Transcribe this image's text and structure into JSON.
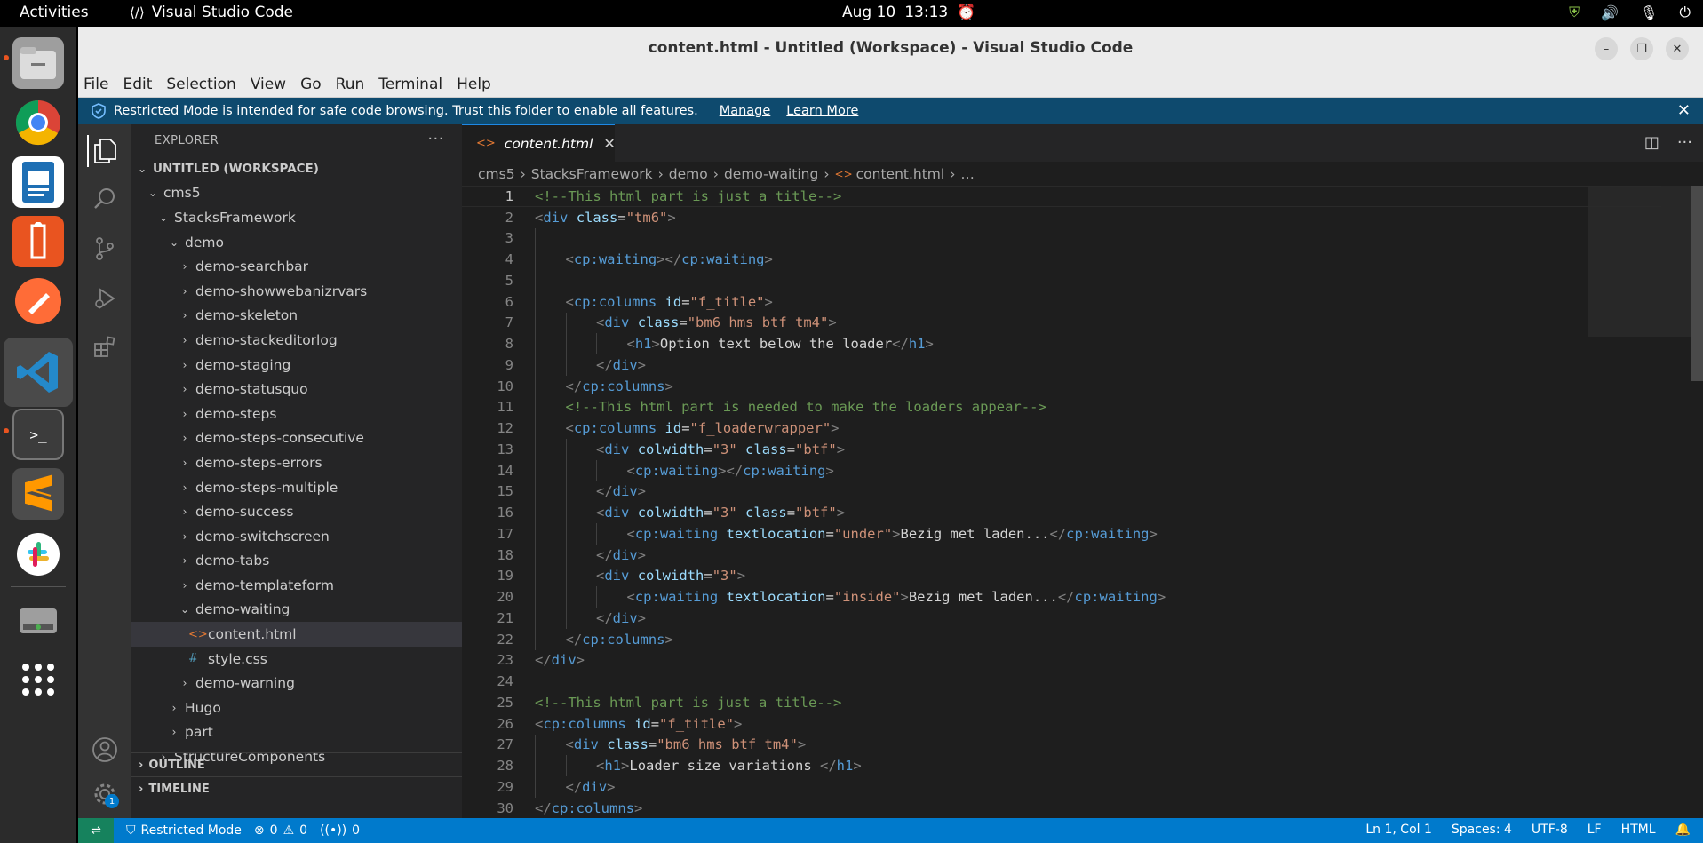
{
  "topbar": {
    "activities": "Activities",
    "app_name": "Visual Studio Code",
    "date": "Aug 10",
    "time": "13:13"
  },
  "window": {
    "title": "content.html - Untitled (Workspace) - Visual Studio Code"
  },
  "menu": [
    "File",
    "Edit",
    "Selection",
    "View",
    "Go",
    "Run",
    "Terminal",
    "Help"
  ],
  "banner": {
    "text": "Restricted Mode is intended for safe code browsing. Trust this folder to enable all features.",
    "manage": "Manage",
    "learn_more": "Learn More"
  },
  "explorer": {
    "header": "EXPLORER",
    "workspace": "UNTITLED (WORKSPACE)",
    "tree": [
      {
        "label": "cms5",
        "depth": 1,
        "chev": "⌄"
      },
      {
        "label": "StacksFramework",
        "depth": 2,
        "chev": "⌄"
      },
      {
        "label": "demo",
        "depth": 3,
        "chev": "⌄"
      },
      {
        "label": "demo-searchbar",
        "depth": 4,
        "chev": "›"
      },
      {
        "label": "demo-showwebanizrvars",
        "depth": 4,
        "chev": "›"
      },
      {
        "label": "demo-skeleton",
        "depth": 4,
        "chev": "›"
      },
      {
        "label": "demo-stackeditorlog",
        "depth": 4,
        "chev": "›"
      },
      {
        "label": "demo-staging",
        "depth": 4,
        "chev": "›"
      },
      {
        "label": "demo-statusquo",
        "depth": 4,
        "chev": "›"
      },
      {
        "label": "demo-steps",
        "depth": 4,
        "chev": "›"
      },
      {
        "label": "demo-steps-consecutive",
        "depth": 4,
        "chev": "›"
      },
      {
        "label": "demo-steps-errors",
        "depth": 4,
        "chev": "›"
      },
      {
        "label": "demo-steps-multiple",
        "depth": 4,
        "chev": "›"
      },
      {
        "label": "demo-success",
        "depth": 4,
        "chev": "›"
      },
      {
        "label": "demo-switchscreen",
        "depth": 4,
        "chev": "›"
      },
      {
        "label": "demo-tabs",
        "depth": 4,
        "chev": "›"
      },
      {
        "label": "demo-templateform",
        "depth": 4,
        "chev": "›"
      },
      {
        "label": "demo-waiting",
        "depth": 4,
        "chev": "⌄"
      },
      {
        "label": "content.html",
        "depth": 5,
        "file": "html",
        "selected": true
      },
      {
        "label": "style.css",
        "depth": 5,
        "file": "css"
      },
      {
        "label": "demo-warning",
        "depth": 4,
        "chev": "›"
      },
      {
        "label": "Hugo",
        "depth": 3,
        "chev": "›"
      },
      {
        "label": "part",
        "depth": 3,
        "chev": "›"
      },
      {
        "label": "StructureComponents",
        "depth": 2,
        "chev": "›"
      }
    ],
    "outline": "OUTLINE",
    "timeline": "TIMELINE"
  },
  "tab": {
    "label": "content.html"
  },
  "breadcrumb": [
    "cms5",
    "StacksFramework",
    "demo",
    "demo-waiting",
    "content.html",
    "…"
  ],
  "code": [
    {
      "n": "1",
      "indent": 0,
      "tokens": [
        [
          "c",
          "<!--This html part is just a title-->"
        ]
      ]
    },
    {
      "n": "2",
      "indent": 0,
      "tokens": [
        [
          "p",
          "<"
        ],
        [
          "t",
          "div"
        ],
        [
          "x",
          " "
        ],
        [
          "a",
          "class"
        ],
        [
          "x",
          "="
        ],
        [
          "s",
          "\"tm6\""
        ],
        [
          "p",
          ">"
        ]
      ]
    },
    {
      "n": "3",
      "indent": 1,
      "tokens": []
    },
    {
      "n": "4",
      "indent": 1,
      "tokens": [
        [
          "p",
          "<"
        ],
        [
          "t",
          "cp:waiting"
        ],
        [
          "p",
          "></"
        ],
        [
          "t",
          "cp:waiting"
        ],
        [
          "p",
          ">"
        ]
      ]
    },
    {
      "n": "5",
      "indent": 1,
      "tokens": []
    },
    {
      "n": "6",
      "indent": 1,
      "tokens": [
        [
          "p",
          "<"
        ],
        [
          "t",
          "cp:columns"
        ],
        [
          "x",
          " "
        ],
        [
          "a",
          "id"
        ],
        [
          "x",
          "="
        ],
        [
          "s",
          "\"f_title\""
        ],
        [
          "p",
          ">"
        ]
      ]
    },
    {
      "n": "7",
      "indent": 2,
      "tokens": [
        [
          "p",
          "<"
        ],
        [
          "t",
          "div"
        ],
        [
          "x",
          " "
        ],
        [
          "a",
          "class"
        ],
        [
          "x",
          "="
        ],
        [
          "s",
          "\"bm6 hms btf tm4\""
        ],
        [
          "p",
          ">"
        ]
      ]
    },
    {
      "n": "8",
      "indent": 3,
      "tokens": [
        [
          "p",
          "<"
        ],
        [
          "t",
          "h1"
        ],
        [
          "p",
          ">"
        ],
        [
          "x",
          "Option text below the loader"
        ],
        [
          "p",
          "</"
        ],
        [
          "t",
          "h1"
        ],
        [
          "p",
          ">"
        ]
      ]
    },
    {
      "n": "9",
      "indent": 2,
      "tokens": [
        [
          "p",
          "</"
        ],
        [
          "t",
          "div"
        ],
        [
          "p",
          ">"
        ]
      ]
    },
    {
      "n": "10",
      "indent": 1,
      "tokens": [
        [
          "p",
          "</"
        ],
        [
          "t",
          "cp:columns"
        ],
        [
          "p",
          ">"
        ]
      ]
    },
    {
      "n": "11",
      "indent": 1,
      "tokens": [
        [
          "c",
          "<!--This html part is needed to make the loaders appear-->"
        ]
      ]
    },
    {
      "n": "12",
      "indent": 1,
      "tokens": [
        [
          "p",
          "<"
        ],
        [
          "t",
          "cp:columns"
        ],
        [
          "x",
          " "
        ],
        [
          "a",
          "id"
        ],
        [
          "x",
          "="
        ],
        [
          "s",
          "\"f_loaderwrapper\""
        ],
        [
          "p",
          ">"
        ]
      ]
    },
    {
      "n": "13",
      "indent": 2,
      "tokens": [
        [
          "p",
          "<"
        ],
        [
          "t",
          "div"
        ],
        [
          "x",
          " "
        ],
        [
          "a",
          "colwidth"
        ],
        [
          "x",
          "="
        ],
        [
          "s",
          "\"3\""
        ],
        [
          "x",
          " "
        ],
        [
          "a",
          "class"
        ],
        [
          "x",
          "="
        ],
        [
          "s",
          "\"btf\""
        ],
        [
          "p",
          ">"
        ]
      ]
    },
    {
      "n": "14",
      "indent": 3,
      "tokens": [
        [
          "p",
          "<"
        ],
        [
          "t",
          "cp:waiting"
        ],
        [
          "p",
          "></"
        ],
        [
          "t",
          "cp:waiting"
        ],
        [
          "p",
          ">"
        ]
      ]
    },
    {
      "n": "15",
      "indent": 2,
      "tokens": [
        [
          "p",
          "</"
        ],
        [
          "t",
          "div"
        ],
        [
          "p",
          ">"
        ]
      ]
    },
    {
      "n": "16",
      "indent": 2,
      "tokens": [
        [
          "p",
          "<"
        ],
        [
          "t",
          "div"
        ],
        [
          "x",
          " "
        ],
        [
          "a",
          "colwidth"
        ],
        [
          "x",
          "="
        ],
        [
          "s",
          "\"3\""
        ],
        [
          "x",
          " "
        ],
        [
          "a",
          "class"
        ],
        [
          "x",
          "="
        ],
        [
          "s",
          "\"btf\""
        ],
        [
          "p",
          ">"
        ]
      ]
    },
    {
      "n": "17",
      "indent": 3,
      "tokens": [
        [
          "p",
          "<"
        ],
        [
          "t",
          "cp:waiting"
        ],
        [
          "x",
          " "
        ],
        [
          "a",
          "textlocation"
        ],
        [
          "x",
          "="
        ],
        [
          "s",
          "\"under\""
        ],
        [
          "p",
          ">"
        ],
        [
          "x",
          "Bezig met laden..."
        ],
        [
          "p",
          "</"
        ],
        [
          "t",
          "cp:waiting"
        ],
        [
          "p",
          ">"
        ]
      ]
    },
    {
      "n": "18",
      "indent": 2,
      "tokens": [
        [
          "p",
          "</"
        ],
        [
          "t",
          "div"
        ],
        [
          "p",
          ">"
        ]
      ]
    },
    {
      "n": "19",
      "indent": 2,
      "tokens": [
        [
          "p",
          "<"
        ],
        [
          "t",
          "div"
        ],
        [
          "x",
          " "
        ],
        [
          "a",
          "colwidth"
        ],
        [
          "x",
          "="
        ],
        [
          "s",
          "\"3\""
        ],
        [
          "p",
          ">"
        ]
      ]
    },
    {
      "n": "20",
      "indent": 3,
      "tokens": [
        [
          "p",
          "<"
        ],
        [
          "t",
          "cp:waiting"
        ],
        [
          "x",
          " "
        ],
        [
          "a",
          "textlocation"
        ],
        [
          "x",
          "="
        ],
        [
          "s",
          "\"inside\""
        ],
        [
          "p",
          ">"
        ],
        [
          "x",
          "Bezig met laden..."
        ],
        [
          "p",
          "</"
        ],
        [
          "t",
          "cp:waiting"
        ],
        [
          "p",
          ">"
        ]
      ]
    },
    {
      "n": "21",
      "indent": 2,
      "tokens": [
        [
          "p",
          "</"
        ],
        [
          "t",
          "div"
        ],
        [
          "p",
          ">"
        ]
      ]
    },
    {
      "n": "22",
      "indent": 1,
      "tokens": [
        [
          "p",
          "</"
        ],
        [
          "t",
          "cp:columns"
        ],
        [
          "p",
          ">"
        ]
      ]
    },
    {
      "n": "23",
      "indent": 0,
      "tokens": [
        [
          "p",
          "</"
        ],
        [
          "t",
          "div"
        ],
        [
          "p",
          ">"
        ]
      ]
    },
    {
      "n": "24",
      "indent": 0,
      "tokens": []
    },
    {
      "n": "25",
      "indent": 0,
      "tokens": [
        [
          "c",
          "<!--This html part is just a title-->"
        ]
      ]
    },
    {
      "n": "26",
      "indent": 0,
      "tokens": [
        [
          "p",
          "<"
        ],
        [
          "t",
          "cp:columns"
        ],
        [
          "x",
          " "
        ],
        [
          "a",
          "id"
        ],
        [
          "x",
          "="
        ],
        [
          "s",
          "\"f_title\""
        ],
        [
          "p",
          ">"
        ]
      ]
    },
    {
      "n": "27",
      "indent": 1,
      "tokens": [
        [
          "p",
          "<"
        ],
        [
          "t",
          "div"
        ],
        [
          "x",
          " "
        ],
        [
          "a",
          "class"
        ],
        [
          "x",
          "="
        ],
        [
          "s",
          "\"bm6 hms btf tm4\""
        ],
        [
          "p",
          ">"
        ]
      ]
    },
    {
      "n": "28",
      "indent": 2,
      "tokens": [
        [
          "p",
          "<"
        ],
        [
          "t",
          "h1"
        ],
        [
          "p",
          ">"
        ],
        [
          "x",
          "Loader size variations "
        ],
        [
          "p",
          "</"
        ],
        [
          "t",
          "h1"
        ],
        [
          "p",
          ">"
        ]
      ]
    },
    {
      "n": "29",
      "indent": 1,
      "tokens": [
        [
          "p",
          "</"
        ],
        [
          "t",
          "div"
        ],
        [
          "p",
          ">"
        ]
      ]
    },
    {
      "n": "30",
      "indent": 0,
      "tokens": [
        [
          "p",
          "</"
        ],
        [
          "t",
          "cp:columns"
        ],
        [
          "p",
          ">"
        ]
      ]
    }
  ],
  "statusbar": {
    "restricted": "Restricted Mode",
    "errors": "0",
    "warnings": "0",
    "ports": "0",
    "position": "Ln 1, Col 1",
    "spaces": "Spaces: 4",
    "encoding": "UTF-8",
    "eol": "LF",
    "language": "HTML"
  },
  "badges": {
    "settings_badge": "1"
  },
  "colors": {
    "accent": "#007acc",
    "banner": "#0e4a6e",
    "comment": "#6a9955",
    "tag": "#569cd6",
    "attr": "#9cdcfe",
    "string": "#ce9178"
  }
}
